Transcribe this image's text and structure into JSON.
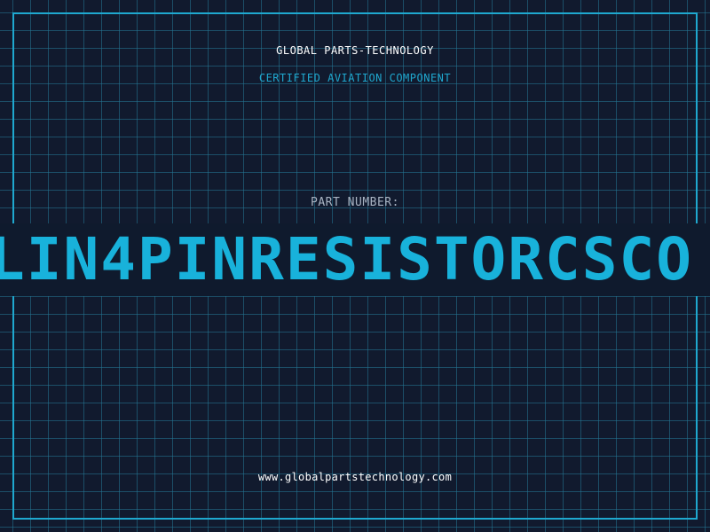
{
  "header": {
    "company": "GLOBAL PARTS-TECHNOLOGY",
    "tagline": "CERTIFIED AVIATION COMPONENT"
  },
  "part": {
    "label": "PART NUMBER:",
    "number": "LIN4PINRESISTORCSCO"
  },
  "footer": {
    "website": "www.globalpartstechnology.com"
  },
  "colors": {
    "background": "#111a2e",
    "accent": "#1fa8cf",
    "grid": "#247896"
  }
}
